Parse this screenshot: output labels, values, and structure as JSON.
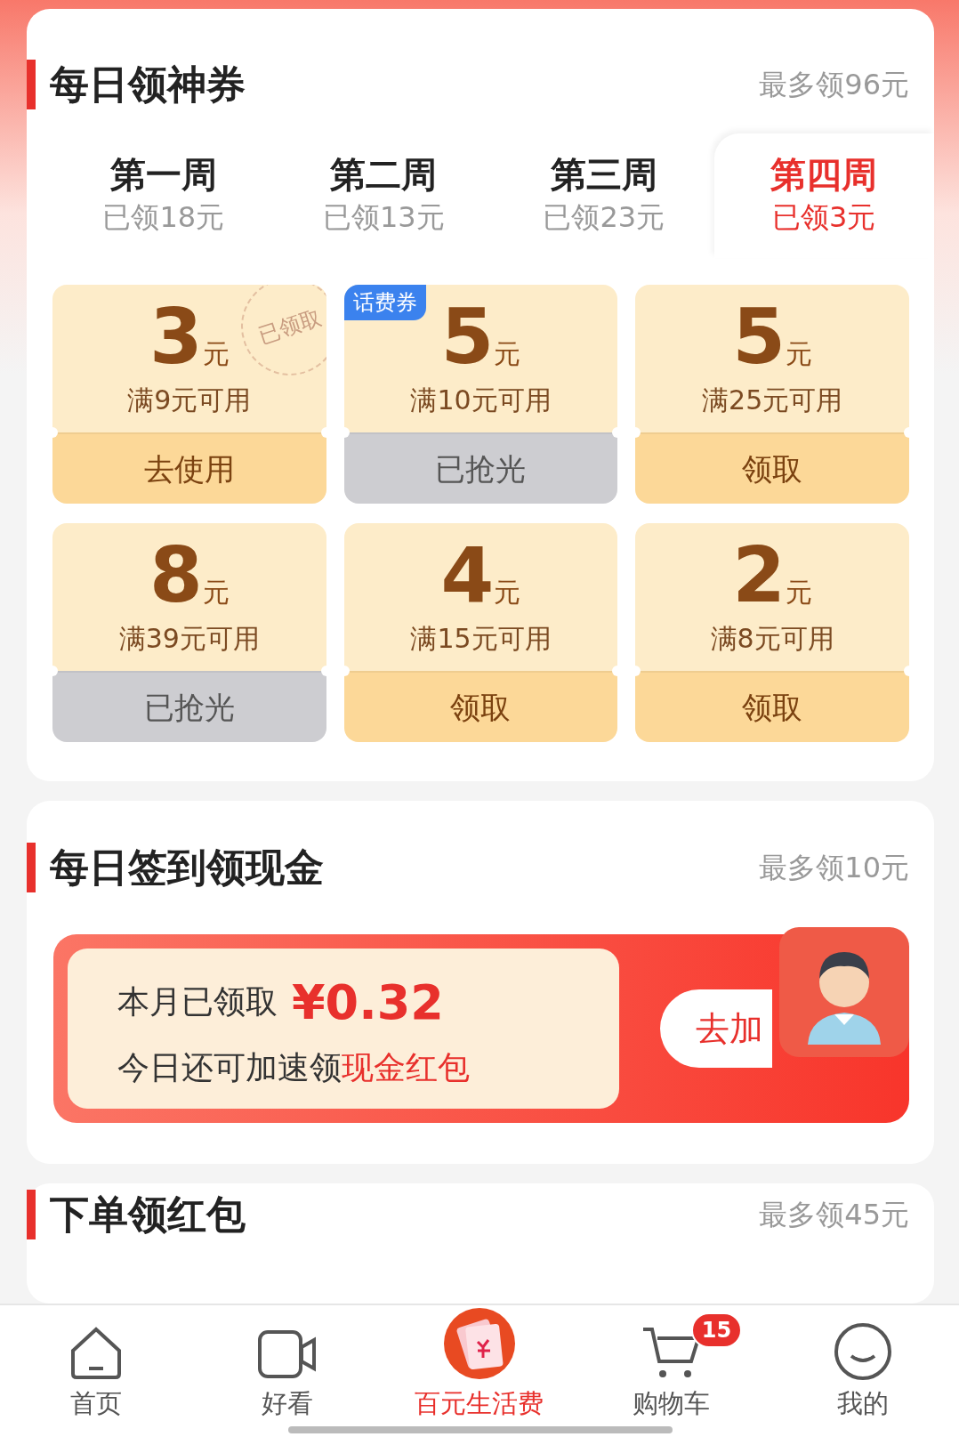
{
  "sections": [
    {
      "title": "每日领神券",
      "note": "最多领96元",
      "kind": "coupons",
      "tabs": [
        {
          "label": "第一周",
          "sub": "已领18元",
          "selected": false
        },
        {
          "label": "第二周",
          "sub": "已领13元",
          "selected": false
        },
        {
          "label": "第三周",
          "sub": "已领23元",
          "selected": false
        },
        {
          "label": "第四周",
          "sub": "已领3元",
          "selected": true
        }
      ],
      "coupons": [
        {
          "amount": "3",
          "unit": "元",
          "condition": "满9元可用",
          "action": "去使用",
          "disabled": false,
          "stamp": "已领取"
        },
        {
          "amount": "5",
          "unit": "元",
          "condition": "满10元可用",
          "action": "已抢光",
          "disabled": true,
          "tag": "话费券"
        },
        {
          "amount": "5",
          "unit": "元",
          "condition": "满25元可用",
          "action": "领取",
          "disabled": false
        },
        {
          "amount": "8",
          "unit": "元",
          "condition": "满39元可用",
          "action": "已抢光",
          "disabled": true
        },
        {
          "amount": "4",
          "unit": "元",
          "condition": "满15元可用",
          "action": "领取",
          "disabled": false
        },
        {
          "amount": "2",
          "unit": "元",
          "condition": "满8元可用",
          "action": "领取",
          "disabled": false
        }
      ]
    },
    {
      "title": "每日签到领现金",
      "note": "最多领10元",
      "kind": "cash",
      "banner": {
        "label": "本月已领取",
        "amount": "¥0.32",
        "line": "今日还可加速领",
        "highlight": "现金红包",
        "button": "去加"
      }
    },
    {
      "title": "下单领红包",
      "note": "最多领45元",
      "kind": "header"
    }
  ],
  "nav": [
    {
      "label": "首页",
      "selected": false
    },
    {
      "label": "好看",
      "selected": false
    },
    {
      "label": "百元生活费",
      "selected": true
    },
    {
      "label": "购物车",
      "selected": false,
      "badge": "15"
    },
    {
      "label": "我的",
      "selected": false
    }
  ]
}
